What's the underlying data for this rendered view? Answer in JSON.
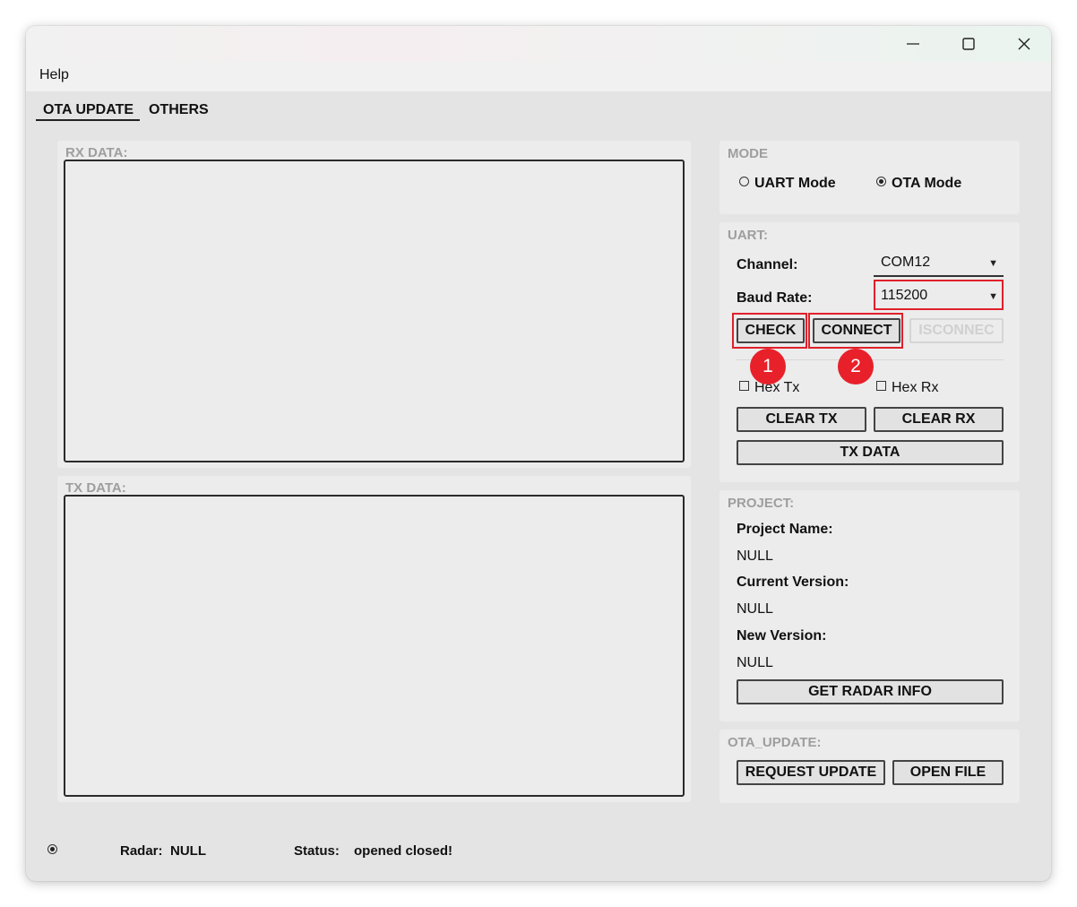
{
  "menu": {
    "help": "Help"
  },
  "tabs": [
    {
      "label": "OTA UPDATE"
    },
    {
      "label": "OTHERS"
    }
  ],
  "rx": {
    "title": "RX DATA:"
  },
  "tx": {
    "title": "TX DATA:"
  },
  "mode": {
    "title": "MODE",
    "uart_label": "UART Mode",
    "ota_label": "OTA Mode",
    "selected": "OTA Mode"
  },
  "uart": {
    "title": "UART:",
    "channel_label": "Channel:",
    "channel_value": "COM12",
    "baud_label": "Baud Rate:",
    "baud_value": "115200",
    "check_label": "CHECK",
    "connect_label": "CONNECT",
    "disconnect_label": "ISCONNEC",
    "hex_tx_label": "Hex Tx",
    "hex_rx_label": "Hex Rx",
    "clear_tx_label": "CLEAR TX",
    "clear_rx_label": "CLEAR RX",
    "tx_data_label": "TX DATA"
  },
  "annotations": {
    "badge_1": "1",
    "badge_2": "2",
    "highlight_color": "#e0202a"
  },
  "project": {
    "title": "PROJECT:",
    "name_label": "Project Name:",
    "name_value": "NULL",
    "current_label": "Current Version:",
    "current_value": "NULL",
    "new_label": "New Version:",
    "new_value": "NULL",
    "get_info_label": "GET RADAR INFO"
  },
  "ota_update": {
    "title": "OTA_UPDATE:",
    "request_label": "REQUEST UPDATE",
    "open_file_label": "OPEN FILE"
  },
  "status": {
    "radar_label": "Radar:",
    "radar_value": "NULL",
    "status_label": "Status:",
    "status_value": "opened closed!"
  }
}
